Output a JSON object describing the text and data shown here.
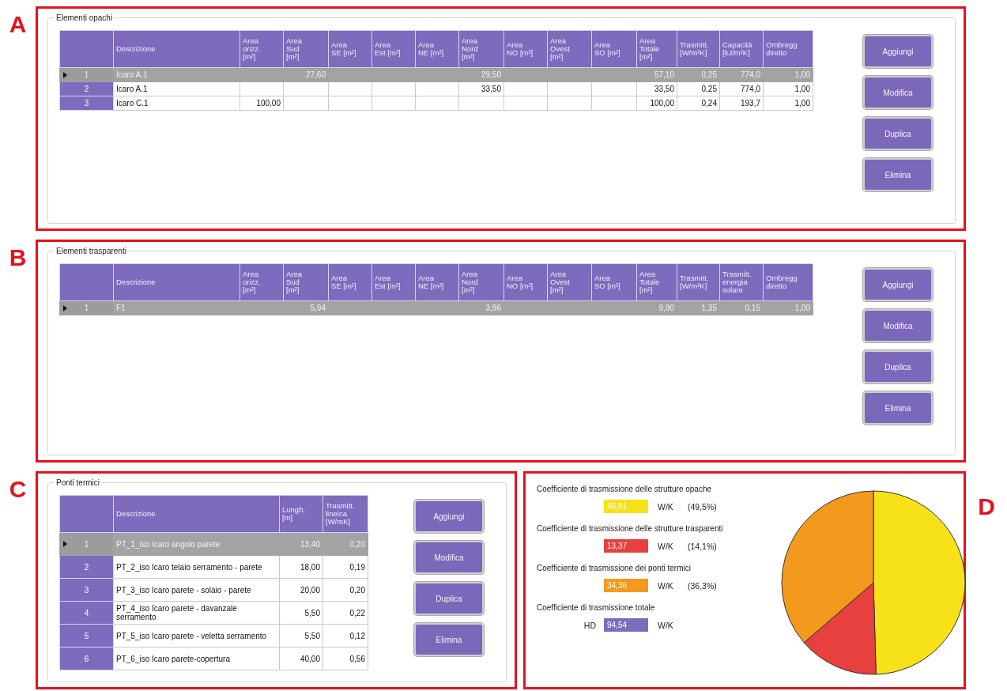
{
  "opaque": {
    "label": "A",
    "title": "Elementi opachi",
    "columns": [
      "Descrizione",
      "Area\norizz.\n[m²]",
      "Area\nSud\n[m²]",
      "Area\nSE [m²]",
      "Area\nEst [m²]",
      "Area\nNE [m²]",
      "Area\nNord\n[m²]",
      "Area\nNO [m²]",
      "Area\nOvest\n[m²]",
      "Area\nSO [m²]",
      "Area\nTotale\n[m²]",
      "Trasmitt.\n[W/m²K]",
      "Capacità\n[kJ/m²K]",
      "Ombregg\ndiretto"
    ],
    "rows": [
      {
        "number": "1",
        "selected": true,
        "cells": [
          "Icaro A.1",
          null,
          "27,60",
          null,
          null,
          null,
          "29,50",
          null,
          null,
          null,
          "57,10",
          "0,25",
          "774,0",
          "1,00"
        ]
      },
      {
        "number": "2",
        "selected": false,
        "cells": [
          "Icaro A.1",
          null,
          null,
          null,
          null,
          null,
          "33,50",
          null,
          null,
          null,
          "33,50",
          "0,25",
          "774,0",
          "1,00"
        ]
      },
      {
        "number": "3",
        "selected": false,
        "cells": [
          "Icaro C.1",
          "100,00",
          null,
          null,
          null,
          null,
          null,
          null,
          null,
          null,
          "100,00",
          "0,24",
          "193,7",
          "1,00"
        ]
      }
    ],
    "buttons": [
      "Aggiungi",
      "Modifica",
      "Duplica",
      "Elimina"
    ]
  },
  "transparent": {
    "label": "B",
    "title": "Elementi trasparenti",
    "columns": [
      "Descrizione",
      "Area\norizz.\n[m²]",
      "Area\nSud\n[m²]",
      "Area\nSE [m²]",
      "Area\nEst [m²]",
      "Area\nNE [m²]",
      "Area\nNord\n[m²]",
      "Area\nNO [m²]",
      "Area\nOvest\n[m²]",
      "Area\nSO [m²]",
      "Area\nTotale\n[m²]",
      "Trasmitt.\n[W/m²K]",
      "Trasmitt.\nenergia\nsolare",
      "Ombregg\ndiretto"
    ],
    "rows": [
      {
        "number": "1",
        "selected": true,
        "cells": [
          "F1",
          null,
          "5,94",
          null,
          null,
          null,
          "3,96",
          null,
          null,
          null,
          "9,90",
          "1,35",
          "0,15",
          "1,00"
        ]
      }
    ],
    "buttons": [
      "Aggiungi",
      "Modifica",
      "Duplica",
      "Elimina"
    ]
  },
  "thermal_bridges": {
    "label": "C",
    "title": "Ponti termici",
    "columns": [
      "Descrizione",
      "Lungh.\n[m]",
      "Trasmitt.\nlineica\n[W/mK]"
    ],
    "rows": [
      {
        "number": "1",
        "selected": true,
        "cells": [
          "PT_1_iso Icaro angolo parete",
          "13,40",
          "0,20"
        ]
      },
      {
        "number": "2",
        "selected": false,
        "cells": [
          "PT_2_iso Icaro telaio serramento - parete",
          "18,00",
          "0,19"
        ]
      },
      {
        "number": "3",
        "selected": false,
        "cells": [
          "PT_3_iso Icaro parete - solaio - parete",
          "20,00",
          "0,20"
        ]
      },
      {
        "number": "4",
        "selected": false,
        "cells": [
          "PT_4_iso Icaro parete - davanzale serramento",
          "5,50",
          "0,22"
        ]
      },
      {
        "number": "5",
        "selected": false,
        "cells": [
          "PT_5_iso Icaro parete - veletta serramento",
          "5,50",
          "0,12"
        ]
      },
      {
        "number": "6",
        "selected": false,
        "cells": [
          "PT_6_iso Icaro parete-copertura",
          "40,00",
          "0,56"
        ]
      }
    ],
    "buttons": [
      "Aggiungi",
      "Modifica",
      "Duplica",
      "Elimina"
    ]
  },
  "summary": {
    "label": "D",
    "items": [
      {
        "label": "Coefficiente di trasmissione delle strutture opache",
        "value": "46,81",
        "unit": "W/K",
        "percent": "(49,5%)",
        "color": "#f7e21a"
      },
      {
        "label": "Coefficiente di trasmissione delle strutture trasparenti",
        "value": "13,37",
        "unit": "W/K",
        "percent": "(14,1%)",
        "color": "#e8403f"
      },
      {
        "label": "Coefficiente di trasmissione dei ponti termici",
        "value": "34,36",
        "unit": "W/K",
        "percent": "(36,3%)",
        "color": "#f39a1e"
      }
    ],
    "total": {
      "label": "Coefficiente di trasmissione totale",
      "prefix": "HD",
      "value": "94,54",
      "unit": "W/K",
      "color": "#7d6bbd"
    },
    "chart_data": {
      "type": "pie",
      "values": [
        49.5,
        14.1,
        36.3
      ]
    }
  }
}
